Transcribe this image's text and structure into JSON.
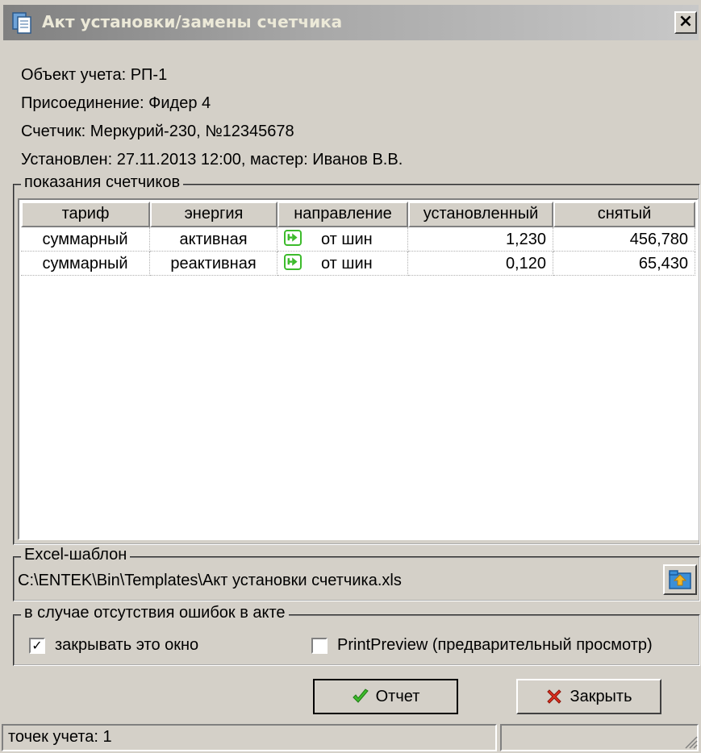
{
  "window": {
    "title": "Акт установки/замены счетчика",
    "close_label": "×"
  },
  "info": {
    "object": "Объект учета: РП-1",
    "connection": "Присоединение: Фидер 4",
    "meter": "Счетчик: Меркурий-230, №12345678",
    "installed": "Установлен: 27.11.2013 12:00, мастер: Иванов В.В."
  },
  "readings_group": {
    "legend": "показания счетчиков",
    "columns": [
      "тариф",
      "энергия",
      "направление",
      "установленный",
      "снятый"
    ],
    "rows": [
      {
        "tariff": "суммарный",
        "energy": "активная",
        "direction_icon": "direction-arrow-icon",
        "direction": "от шин",
        "installed": "1,230",
        "removed": "456,780"
      },
      {
        "tariff": "суммарный",
        "energy": "реактивная",
        "direction_icon": "direction-arrow-icon",
        "direction": "от шин",
        "installed": "0,120",
        "removed": "65,430"
      }
    ]
  },
  "template_group": {
    "legend": "Excel-шаблон",
    "path": "C:\\ENTEK\\Bin\\Templates\\Акт установки счетчика.xls",
    "open_icon": "open-folder-icon"
  },
  "options_group": {
    "legend": "в случае отсутствия ошибок в акте",
    "close_window": {
      "label": "закрывать это окно",
      "checked": true
    },
    "print_preview": {
      "label": "PrintPreview (предварительный просмотр)",
      "checked": false
    }
  },
  "buttons": {
    "report": {
      "label": "Отчет",
      "icon": "checkmark-icon"
    },
    "close": {
      "label": "Закрыть",
      "icon": "red-x-icon"
    }
  },
  "status": {
    "points": "точек учета: 1",
    "secondary": ""
  },
  "colors": {
    "window_bg": "#d4d0c8",
    "title_gradient_start": "#808080",
    "accent_green": "#3dbb2c",
    "accent_red": "#e03020"
  }
}
